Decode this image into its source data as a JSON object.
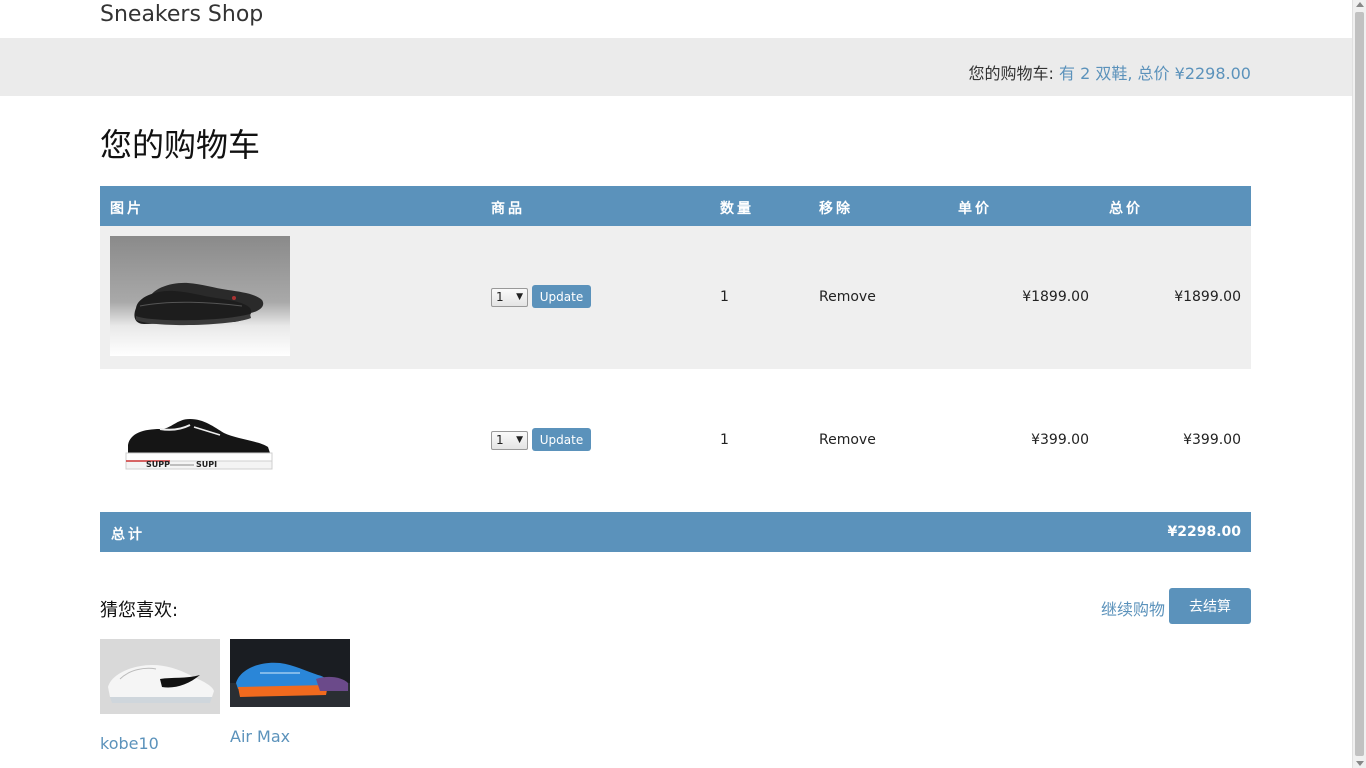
{
  "header": {
    "brand": "Sneakers Shop",
    "cart_label": "您的购物车: ",
    "cart_link": "有 2 双鞋, 总价 ¥2298.00"
  },
  "page_title": "您的购物车",
  "table": {
    "columns": [
      "图片",
      "商品",
      "数量",
      "移除",
      "单价",
      "总价"
    ],
    "rows": [
      {
        "quantity_select": "1",
        "update_label": "Update",
        "quantity": "1",
        "remove_label": "Remove",
        "unit_price": "¥1899.00",
        "total_price": "¥1899.00"
      },
      {
        "quantity_select": "1",
        "update_label": "Update",
        "quantity": "1",
        "remove_label": "Remove",
        "unit_price": "¥399.00",
        "total_price": "¥399.00"
      }
    ],
    "footer_label": "总计",
    "footer_total": "¥2298.00"
  },
  "suggestions": {
    "title": "猜您喜欢:",
    "items": [
      {
        "name": "kobe10"
      },
      {
        "name": "Air Max"
      }
    ]
  },
  "actions": {
    "continue_label": "继续购物",
    "checkout_label": "去结算"
  },
  "colors": {
    "accent": "#5b92bb",
    "header_band": "#ebebeb",
    "row_alt": "#efefef"
  }
}
